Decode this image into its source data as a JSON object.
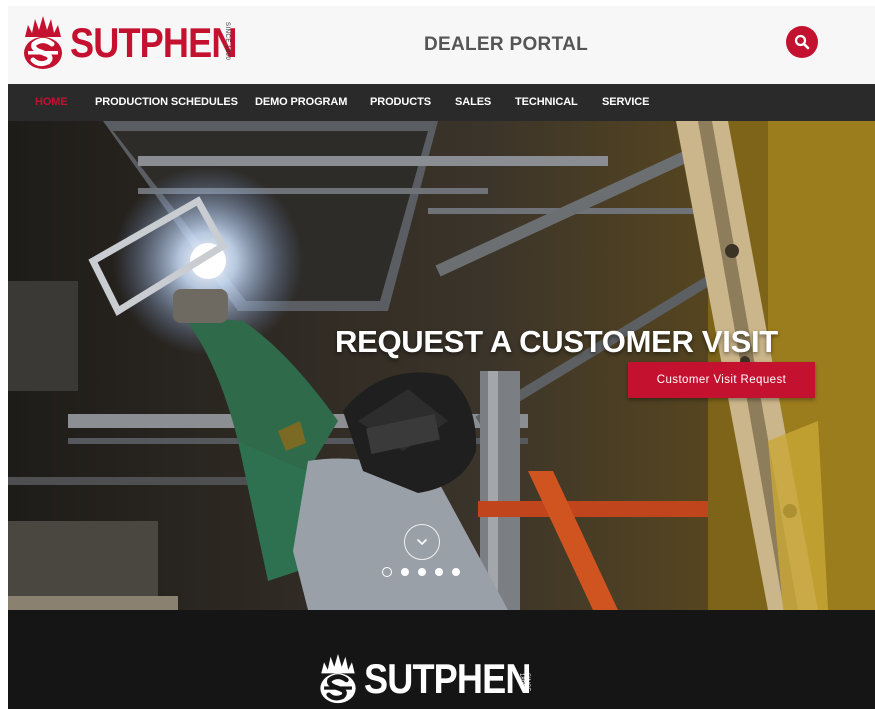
{
  "brand": {
    "name": "SUTPHEN",
    "since": "SINCE 1890",
    "accent_color": "#c4112f"
  },
  "header": {
    "title": "DEALER PORTAL",
    "search_icon": "search-icon"
  },
  "nav": {
    "items": [
      {
        "label": "HOME",
        "active": true
      },
      {
        "label": "PRODUCTION SCHEDULES",
        "active": false
      },
      {
        "label": "DEMO PROGRAM",
        "active": false
      },
      {
        "label": "PRODUCTS",
        "active": false
      },
      {
        "label": "SALES",
        "active": false
      },
      {
        "label": "TECHNICAL",
        "active": false
      },
      {
        "label": "SERVICE",
        "active": false
      }
    ]
  },
  "hero": {
    "headline": "REQUEST A CUSTOMER VISIT",
    "cta_label": "Customer Visit Request",
    "scroll_icon": "chevron-down-icon",
    "slides": 5,
    "active_slide": 1
  },
  "footer": {
    "brand_name": "SUTPHEN",
    "since": "SINCE 1890"
  }
}
